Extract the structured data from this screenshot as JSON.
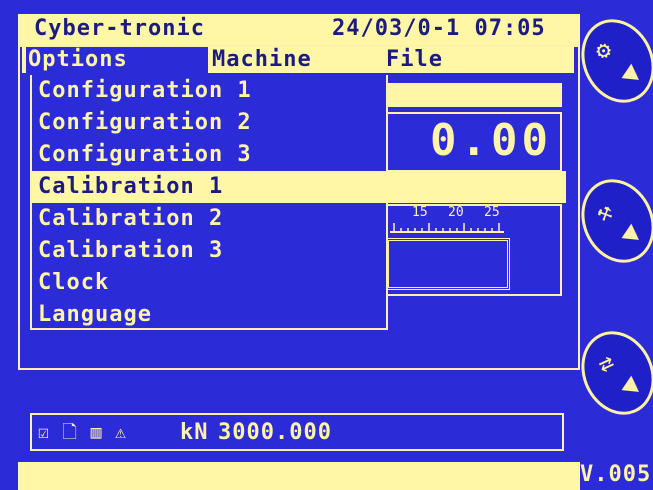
{
  "header": {
    "app_name": "Cyber-tronic",
    "datetime": "24/03/0-1 07:05"
  },
  "menubar": {
    "options": "Options",
    "machine": "Machine",
    "file": "File"
  },
  "options_menu": {
    "items": [
      "Configuration 1",
      "Configuration 2",
      "Configuration 3",
      "Calibration 1",
      "Calibration 2",
      "Calibration 3",
      "Clock",
      "Language"
    ],
    "selected_index": 3
  },
  "display": {
    "value": "0.00"
  },
  "scale": {
    "ticks": [
      "15",
      "20",
      "25"
    ]
  },
  "status": {
    "icons": [
      "checkbox-icon",
      "document-icon",
      "memory-card-icon",
      "alarm-icon"
    ],
    "unit": "kN",
    "value": "3000.000"
  },
  "footer": {
    "version": "V.005"
  },
  "colors": {
    "background": "#2b2bd8",
    "accent": "#fff7a6",
    "text_dark": "#1b1b80"
  }
}
